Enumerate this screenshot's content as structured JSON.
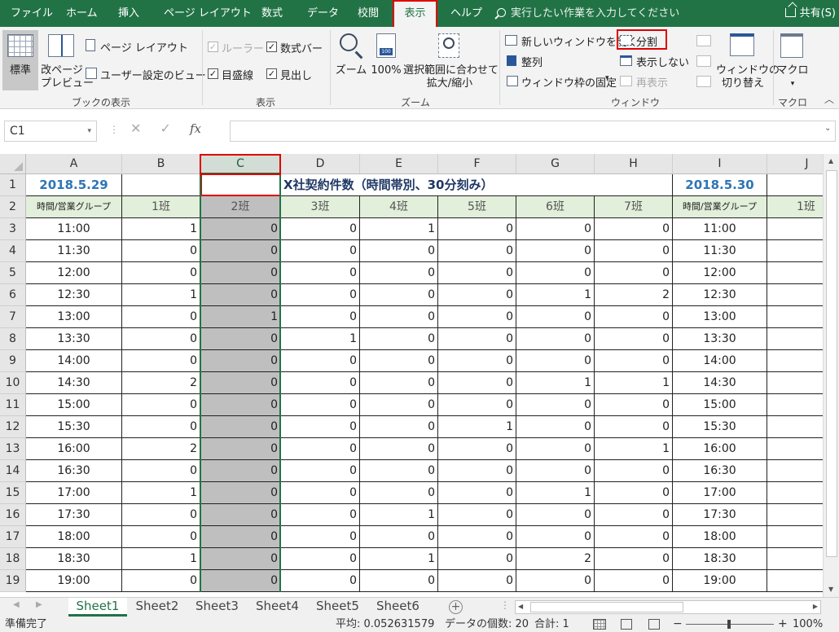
{
  "ribbon_tabs": [
    "ファイル",
    "ホーム",
    "挿入",
    "ページ レイアウト",
    "数式",
    "データ",
    "校閲",
    "表示",
    "ヘルプ"
  ],
  "tell_me": "実行したい作業を入力してください",
  "share": "共有(S)",
  "ribbon": {
    "workbook_views": {
      "normal": "標準",
      "page_break_1": "改ページ",
      "page_break_2": "プレビュー",
      "page_layout": "ページ レイアウト",
      "custom_views": "ユーザー設定のビュー",
      "label": "ブックの表示"
    },
    "show": {
      "ruler": "ルーラー",
      "formula_bar": "数式バー",
      "gridlines": "目盛線",
      "headings": "見出し",
      "label": "表示"
    },
    "zoom": {
      "zoom": "ズーム",
      "hundred": "100%",
      "zoom_sel_1": "選択範囲に合わせて",
      "zoom_sel_2": "拡大/縮小",
      "icon_text": "100",
      "label": "ズーム"
    },
    "window": {
      "new_window": "新しいウィンドウを開く",
      "arrange": "整列",
      "freeze": "ウィンドウ枠の固定",
      "split": "分割",
      "hide": "表示しない",
      "unhide": "再表示",
      "switch_1": "ウィンドウの",
      "switch_2": "切り替え",
      "label": "ウィンドウ"
    },
    "macros": {
      "macro": "マクロ",
      "label": "マクロ"
    }
  },
  "formula_bar": {
    "name_box": "C1",
    "fx": "fx",
    "content": ""
  },
  "columns": [
    "A",
    "B",
    "C",
    "D",
    "E",
    "F",
    "G",
    "H",
    "I",
    "J"
  ],
  "selected_column": "C",
  "sheet": {
    "date1": "2018.5.29",
    "title": "X社契約件数（時間帯別、30分刻み）",
    "date2": "2018.5.30",
    "header_time": "時間/営業グループ",
    "groups": [
      "1班",
      "2班",
      "3班",
      "4班",
      "5班",
      "6班",
      "7班"
    ],
    "groups2": [
      "1班"
    ],
    "times": [
      "11:00",
      "11:30",
      "12:00",
      "12:30",
      "13:00",
      "13:30",
      "14:00",
      "14:30",
      "15:00",
      "15:30",
      "16:00",
      "16:30",
      "17:00",
      "17:30",
      "18:00",
      "18:30",
      "19:00"
    ],
    "values": [
      [
        1,
        0,
        0,
        1,
        0,
        0,
        0
      ],
      [
        0,
        0,
        0,
        0,
        0,
        0,
        0
      ],
      [
        0,
        0,
        0,
        0,
        0,
        0,
        0
      ],
      [
        1,
        0,
        0,
        0,
        0,
        1,
        2
      ],
      [
        0,
        1,
        0,
        0,
        0,
        0,
        0
      ],
      [
        0,
        0,
        1,
        0,
        0,
        0,
        0
      ],
      [
        0,
        0,
        0,
        0,
        0,
        0,
        0
      ],
      [
        2,
        0,
        0,
        0,
        0,
        1,
        1
      ],
      [
        0,
        0,
        0,
        0,
        0,
        0,
        0
      ],
      [
        0,
        0,
        0,
        0,
        1,
        0,
        0
      ],
      [
        2,
        0,
        0,
        0,
        0,
        0,
        1
      ],
      [
        0,
        0,
        0,
        0,
        0,
        0,
        0
      ],
      [
        1,
        0,
        0,
        0,
        0,
        1,
        0
      ],
      [
        0,
        0,
        0,
        1,
        0,
        0,
        0
      ],
      [
        0,
        0,
        0,
        0,
        0,
        0,
        0
      ],
      [
        1,
        0,
        0,
        1,
        0,
        2,
        0
      ],
      [
        0,
        0,
        0,
        0,
        0,
        0,
        0
      ]
    ]
  },
  "sheet_tabs": [
    "Sheet1",
    "Sheet2",
    "Sheet3",
    "Sheet4",
    "Sheet5",
    "Sheet6"
  ],
  "status": {
    "ready": "準備完了",
    "average": "平均: 0.052631579",
    "count": "データの個数: 20",
    "sum": "合計: 1",
    "zoom": "100%"
  },
  "colors": {
    "excel_green": "#217346",
    "date_blue": "#2e75b6",
    "title_navy": "#1f3864",
    "header_fill": "#e2efda",
    "selected_fill": "#bfbfbf",
    "highlight_red": "#e00000"
  }
}
